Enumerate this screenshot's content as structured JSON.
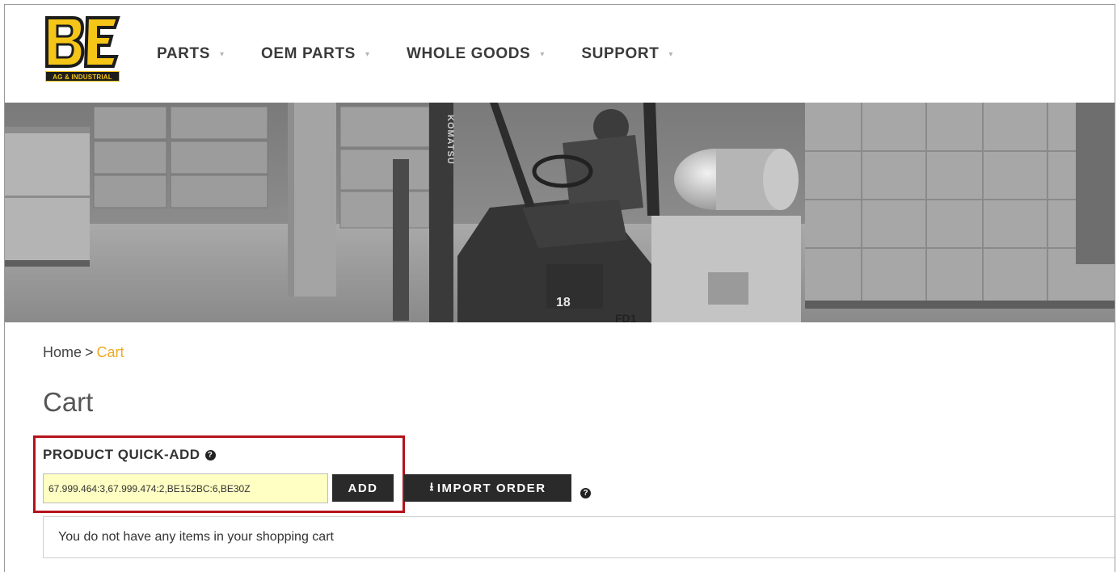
{
  "brand": {
    "logo_text": "BE",
    "logo_sub": "AG & INDUSTRIAL",
    "colors": {
      "yellow": "#f5c518",
      "dark": "#1d1d1b"
    }
  },
  "nav": {
    "items": [
      {
        "label": "PARTS",
        "icon": "chevron-down-icon"
      },
      {
        "label": "OEM PARTS",
        "icon": "chevron-down-icon"
      },
      {
        "label": "WHOLE GOODS",
        "icon": "chevron-down-icon"
      },
      {
        "label": "SUPPORT",
        "icon": "chevron-down-icon"
      }
    ],
    "caret": "▾"
  },
  "hero": {
    "forklift_brand": "KOMATSU",
    "forklift_number": "18",
    "plate_text": "FD1"
  },
  "breadcrumb": {
    "home": "Home",
    "separator": ">",
    "current": "Cart"
  },
  "page": {
    "title": "Cart"
  },
  "quick_add": {
    "label": "PRODUCT QUICK-ADD",
    "help": "?",
    "input_value": "67.999.464:3,67.999.474:2,BE152BC:6,BE30Z",
    "add_label": "ADD",
    "import_icon": "⭳",
    "import_label": "IMPORT ORDER",
    "import_help": "?"
  },
  "cart": {
    "empty_message": "You do not have any items in your shopping cart"
  },
  "colors": {
    "accent": "#f0a81c",
    "highlight_border": "#b5121b",
    "input_bg": "#ffffc4",
    "button_bg": "#2a2a2a"
  }
}
